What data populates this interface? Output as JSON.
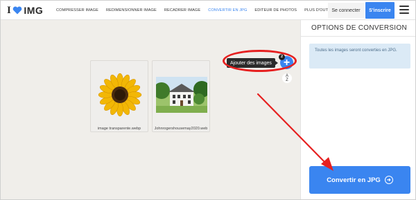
{
  "header": {
    "logo_i": "I",
    "logo_text": "IMG",
    "nav": [
      {
        "label": "COMPRESSER IMAGE",
        "active": false
      },
      {
        "label": "REDIMENSIONNER IMAGE",
        "active": false
      },
      {
        "label": "RECADRER IMAGE",
        "active": false
      },
      {
        "label": "CONVERTIR EN JPG",
        "active": true
      },
      {
        "label": "EDITEUR DE PHOTOS",
        "active": false
      },
      {
        "label": "PLUS D'OUTILS",
        "active": false
      }
    ],
    "login_label": "Se connecter",
    "signup_label": "S'inscrire"
  },
  "workspace": {
    "files": [
      {
        "name": "image transparente.webp",
        "icon": "sunflower-image"
      },
      {
        "name": "Johnrogershousemay2020.web",
        "icon": "house-image"
      }
    ],
    "add_tooltip": "Ajouter des images",
    "file_count": "2",
    "add_symbol": "+",
    "sort_label_top": "A",
    "sort_label_bottom": "Z"
  },
  "sidebar": {
    "title": "OPTIONS DE CONVERSION",
    "info_text": "Toutes les images seront converties en JPG.",
    "convert_label": "Convertir en JPG"
  },
  "colors": {
    "accent": "#3a85f0",
    "annotation": "#e62020",
    "workspace_bg": "#f0eeea"
  }
}
